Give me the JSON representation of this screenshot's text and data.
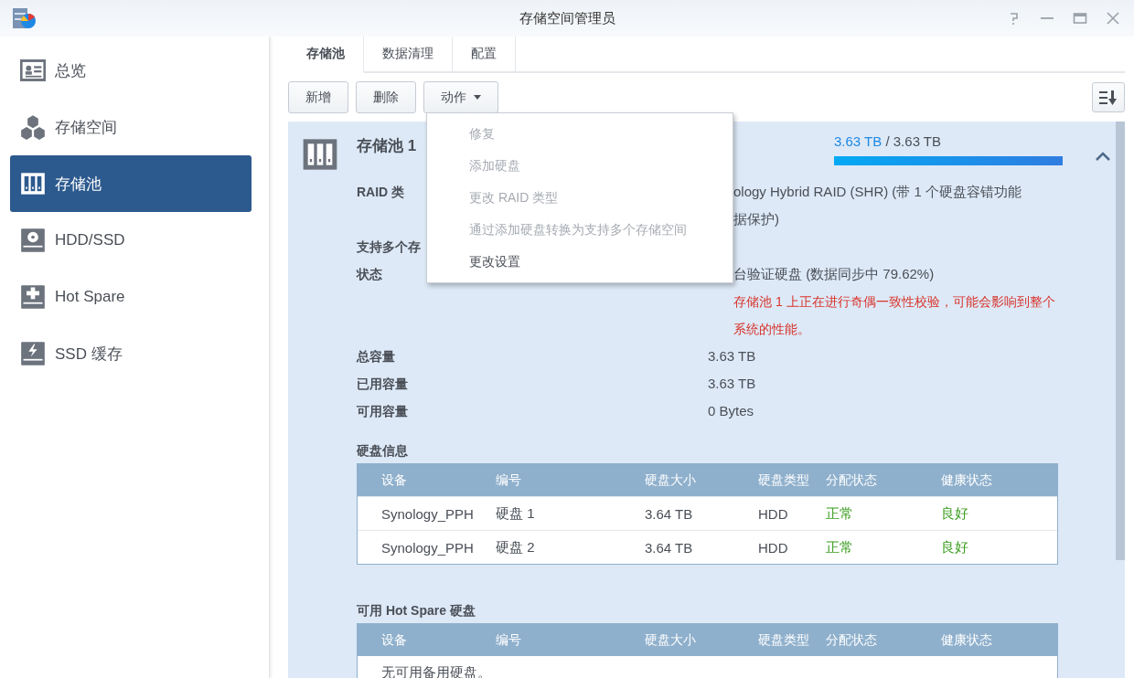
{
  "window": {
    "title": "存储空间管理员"
  },
  "sidebar": {
    "items": [
      {
        "label": "总览",
        "selected": false
      },
      {
        "label": "存储空间",
        "selected": false
      },
      {
        "label": "存储池",
        "selected": true
      },
      {
        "label": "HDD/SSD",
        "selected": false
      },
      {
        "label": "Hot Spare",
        "selected": false
      },
      {
        "label": "SSD 缓存",
        "selected": false
      }
    ]
  },
  "tabs": [
    {
      "label": "存储池",
      "selected": true
    },
    {
      "label": "数据清理",
      "selected": false
    },
    {
      "label": "配置",
      "selected": false
    }
  ],
  "toolbar": {
    "buttons": [
      "新增",
      "删除"
    ],
    "action_button": "动作"
  },
  "action_menu": {
    "items": [
      {
        "label": "修复",
        "disabled": true
      },
      {
        "label": "添加硬盘",
        "disabled": true
      },
      {
        "label": "更改 RAID 类型",
        "disabled": true
      },
      {
        "label": "通过添加硬盘转换为支持多个存储空间",
        "disabled": true
      },
      {
        "label": "更改设置",
        "disabled": false
      }
    ]
  },
  "pool": {
    "title": "存储池 1",
    "used": "3.63 TB",
    "separator": "/",
    "total": "3.63 TB",
    "level": 1,
    "expanded": true,
    "details": [
      {
        "label": "RAID 类",
        "cut": true,
        "lines": [
          "ology Hybrid RAID (SHR) (带 1 个硬盘容错功能",
          "据保护)"
        ]
      },
      {
        "label": "支持多个存"
      },
      {
        "label": "状态",
        "cut": true,
        "lines": [
          "台验证硬盘 (数据同步中 79.62%)"
        ],
        "warning": "存储池 1 上正在进行奇偶一致性校验，可能会影响到整个系统的性能。"
      },
      {
        "label": "总容量",
        "cut": false,
        "lines": [
          "3.63 TB"
        ]
      },
      {
        "label": "已用容量",
        "cut": false,
        "lines": [
          "3.63 TB"
        ]
      },
      {
        "label": "可用容量",
        "cut": false,
        "lines": [
          "0 Bytes"
        ]
      }
    ],
    "tables": [
      {
        "title": "硬盘信息",
        "columns": [
          "设备",
          "编号",
          "硬盘大小",
          "硬盘类型",
          "分配状态",
          "健康状态"
        ],
        "rows": [
          {
            "cells": [
              "Synology_PPH",
              "硬盘 1",
              "3.64 TB",
              "HDD",
              "正常",
              "良好"
            ],
            "allocation_ok": true,
            "health_ok": true
          },
          {
            "cells": [
              "Synology_PPH",
              "硬盘 2",
              "3.64 TB",
              "HDD",
              "正常",
              "良好"
            ],
            "allocation_ok": true,
            "health_ok": true
          }
        ]
      },
      {
        "title": "可用 Hot Spare 硬盘",
        "columns": [
          "设备",
          "编号",
          "硬盘大小",
          "硬盘类型",
          "分配状态",
          "健康状态"
        ],
        "empty_text": "无可用备用硬盘。"
      }
    ]
  }
}
